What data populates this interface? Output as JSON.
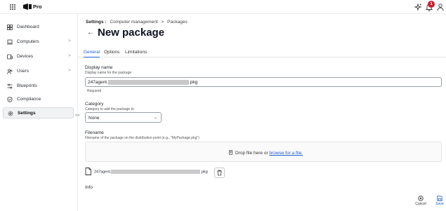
{
  "topbar": {
    "brand": "Pro",
    "notification_count": "1"
  },
  "sidebar": {
    "items": [
      {
        "label": "Dashboard"
      },
      {
        "label": "Computers",
        "chevron": ">"
      },
      {
        "label": "Devices",
        "chevron": ">"
      },
      {
        "label": "Users",
        "chevron": ">"
      },
      {
        "label": "Blueprints"
      },
      {
        "label": "Compliance"
      },
      {
        "label": "Settings"
      }
    ],
    "collapse_label": "<>"
  },
  "breadcrumb": {
    "root": "Settings :",
    "section": "Computer management",
    "sep": ">",
    "current": "Packages"
  },
  "page": {
    "back": "←",
    "title": "New package"
  },
  "tabs": [
    "General",
    "Options",
    "Limitations"
  ],
  "form": {
    "display_name": {
      "label": "Display name",
      "hint": "Display name for the package",
      "value_prefix": "247agent.",
      "value_suffix": ".pkg",
      "required": "Required"
    },
    "category": {
      "label": "Category",
      "hint": "Category to add the package to",
      "value": "None",
      "chevron": "⌄"
    },
    "filename": {
      "label": "Filename",
      "hint": "Filename of the package on the distribution point (e.g., \"MyPackage.pkg\")",
      "drop_text": "Drop file here or",
      "browse_link": "browse for a file.",
      "file_prefix": "247agent.",
      "file_suffix": ".pkg"
    },
    "info_label": "Info"
  },
  "actions": {
    "cancel": "Cancel",
    "save": "Save"
  },
  "colors": {
    "accent": "#1f5fd1",
    "badge": "#c81e2b"
  }
}
